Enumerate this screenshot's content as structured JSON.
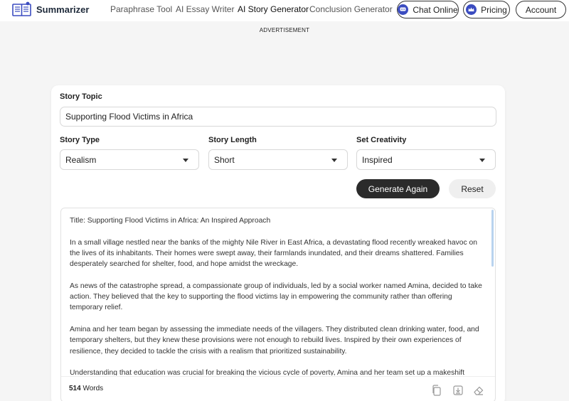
{
  "header": {
    "brand": "Summarizer",
    "nav": [
      "Paraphrase Tool",
      "AI Essay Writer",
      "AI Story Generator",
      "Conclusion Generator"
    ],
    "chat_label": "Chat Online",
    "pricing_label": "Pricing",
    "account_label": "Account"
  },
  "ad_label": "ADVERTISEMENT",
  "form": {
    "topic_label": "Story Topic",
    "topic_value": "Supporting Flood Victims in Africa",
    "type_label": "Story Type",
    "type_value": "Realism",
    "length_label": "Story Length",
    "length_value": "Short",
    "creativity_label": "Set Creativity",
    "creativity_value": "Inspired",
    "generate_label": "Generate Again",
    "reset_label": "Reset"
  },
  "output": {
    "paragraphs": [
      "Title: Supporting Flood Victims in Africa: An Inspired Approach",
      "In a small village nestled near the banks of the mighty Nile River in East Africa, a devastating flood recently wreaked havoc on the lives of its inhabitants. Their homes were swept away, their farmlands inundated, and their dreams shattered. Families desperately searched for shelter, food, and hope amidst the wreckage.",
      "As news of the catastrophe spread, a compassionate group of individuals, led by a social worker named Amina, decided to take action. They believed that the key to supporting the flood victims lay in empowering the community rather than offering temporary relief.",
      "Amina and her team began by assessing the immediate needs of the villagers. They distributed clean drinking water, food, and temporary shelters, but they knew these provisions were not enough to rebuild lives. Inspired by their own experiences of resilience, they decided to tackle the crisis with a realism that prioritized sustainability.",
      "Understanding that education was crucial for breaking the vicious cycle of poverty, Amina and her team set up a makeshift school"
    ],
    "word_count": "514",
    "word_label": "Words"
  },
  "icons": {
    "logo": "book-logo-icon",
    "chat": "chat-bubble-icon",
    "pricing": "crown-icon",
    "copy": "copy-icon",
    "download": "download-icon",
    "erase": "eraser-icon"
  },
  "colors": {
    "brand_blue": "#3b4cc0",
    "dark_button": "#2b2b2b",
    "scrollbar": "#b9d3ef"
  }
}
